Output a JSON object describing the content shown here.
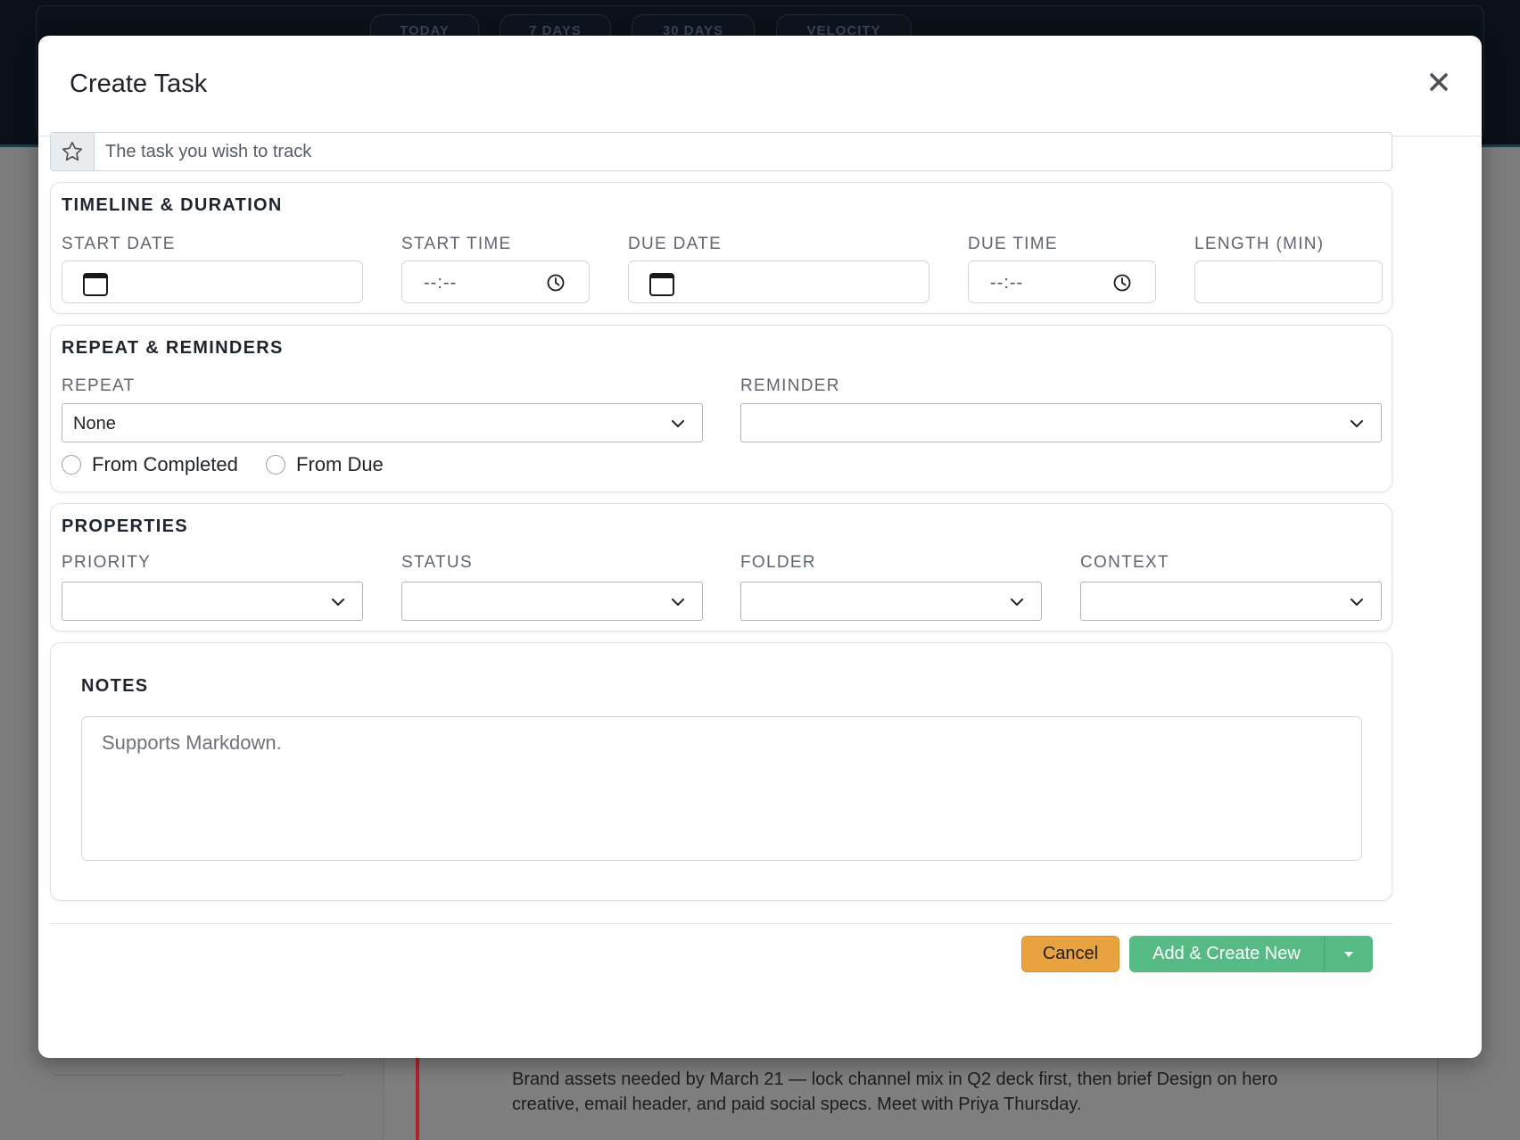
{
  "background": {
    "tabs": [
      "TODAY",
      "7 DAYS",
      "30 DAYS",
      "VELOCITY"
    ],
    "note_text": "Brand assets needed by March 21 — lock channel mix in Q2 deck first, then brief Design on hero creative, email header, and paid social specs. Meet with Priya Thursday."
  },
  "modal": {
    "title": "Create Task",
    "close_label": "×",
    "task_placeholder": "The task you wish to track",
    "timeline": {
      "title": "TIMELINE & DURATION",
      "start_date_label": "START DATE",
      "start_time_label": "START TIME",
      "start_time_value": "--:--",
      "due_date_label": "DUE DATE",
      "due_time_label": "DUE TIME",
      "due_time_value": "--:--",
      "length_label": "LENGTH (MIN)"
    },
    "repeat": {
      "title": "REPEAT & REMINDERS",
      "repeat_label": "REPEAT",
      "repeat_value": "None",
      "reminder_label": "REMINDER",
      "reminder_value": "",
      "from_completed_label": "From Completed",
      "from_due_label": "From Due"
    },
    "properties": {
      "title": "PROPERTIES",
      "priority_label": "PRIORITY",
      "status_label": "STATUS",
      "folder_label": "FOLDER",
      "context_label": "CONTEXT"
    },
    "notes": {
      "title": "NOTES",
      "placeholder": "Supports Markdown."
    },
    "footer": {
      "cancel_label": "Cancel",
      "add_label": "Add & Create New"
    }
  },
  "colors": {
    "cancel": "#e8a23e",
    "add": "#55ba83",
    "topbar": "#0b1119"
  }
}
